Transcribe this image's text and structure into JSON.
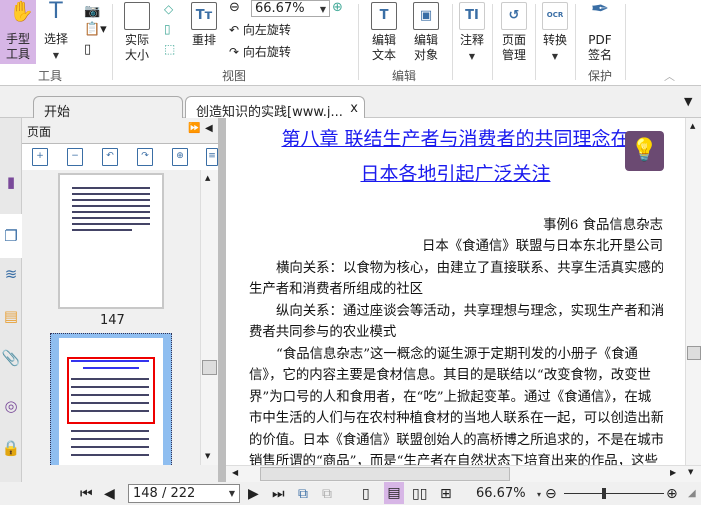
{
  "ribbon": {
    "hand_tool": "手型工具",
    "select": "选择",
    "actual_size": "实际大小",
    "reflow": "重排",
    "zoom_value": "66.67%",
    "rotate_left": "向左旋转",
    "rotate_right": "向右旋转",
    "edit_text": "编辑文本",
    "edit_object": "编辑对象",
    "annotate": "注释",
    "page_manage": "页面管理",
    "convert": "转换",
    "pdf_sign": "PDF签名",
    "groups": {
      "tools": "工具",
      "view": "视图",
      "edit": "编辑",
      "protect": "保护"
    }
  },
  "tabs": [
    {
      "label": "开始"
    },
    {
      "label": "创造知识的实践[www.j..."
    }
  ],
  "tab_close": "x",
  "panel": {
    "title": "页面",
    "thumb_label": "147"
  },
  "document": {
    "title_line1": "第八章 联结生产者与消费者的共同理念在",
    "title_line2": "日本各地引起广泛关注",
    "lines": [
      "事例6 食品信息杂志",
      "日本《食通信》联盟与日本东北开垦公司",
      "横向关系：以食物为核心，由建立了直接联系、共享生活真实感的",
      "生产者和消费者所组成的社区",
      "纵向关系：通过座谈会等活动，共享理想与理念，实现生产者和消",
      "费者共同参与的农业模式",
      "“食品信息杂志”这一概念的诞生源于定期刊发的小册子《食通",
      "信》，它的内容主要是食材信息。其目的是联结以“改变食物，改变世",
      "界”为口号的人和食用者，在“吃”上掀起变革。通过《食通信》，在城",
      "市中生活的人们与在农村种植食材的当地人联系在一起，可以创造出新",
      "的价值。日本《食通信》联盟创始人的高桥博之所追求的，不是在城市",
      "销售所谓的“商品”，而是“生产者在自然状态下培育出来的作品，这些"
    ]
  },
  "status": {
    "page": "148 / 222",
    "zoom": "66.67%",
    "zoom_slider_percent": 40
  },
  "colors": {
    "accent": "#d7b6e6",
    "link": "#1a1aee",
    "tip_bg": "#6b4a72"
  }
}
